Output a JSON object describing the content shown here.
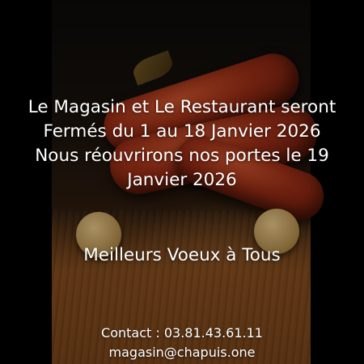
{
  "announcement": {
    "line1": "Le Magasin et Le Restaurant seront",
    "line2": "Fermés du 1 au 18 Janvier 2026",
    "line3": "Nous réouvrirons nos portes le 19",
    "line4": "Janvier 2026"
  },
  "wishes": "Meilleurs Voeux à Tous",
  "contact": {
    "phone_line": "Contact : 03.81.43.61.11",
    "email": "magasin@chapuis.one"
  }
}
